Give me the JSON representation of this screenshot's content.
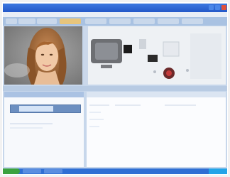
{
  "window": {
    "title": "",
    "controls": {
      "minimize": "",
      "maximize": "",
      "close": ""
    }
  },
  "menu": {
    "items": [
      "",
      "",
      "",
      ""
    ]
  },
  "tabs": [
    {
      "label": "",
      "active": false
    },
    {
      "label": "",
      "active": false
    },
    {
      "label": "",
      "active": false
    },
    {
      "label": "",
      "active": true
    },
    {
      "label": "",
      "active": false
    },
    {
      "label": "",
      "active": false
    },
    {
      "label": "",
      "active": false
    },
    {
      "label": "",
      "active": false
    },
    {
      "label": "",
      "active": false
    }
  ],
  "video": {
    "caption": ""
  },
  "preview": {
    "items": [
      "",
      "",
      ""
    ]
  },
  "connection": {
    "label": ""
  },
  "taskbar": {
    "start_label": "",
    "clock": ""
  },
  "colors": {
    "titlebar": "#2f6fd4",
    "tab_active": "#f2c66a",
    "start_button": "#3aa23f",
    "tray": "#23a4e8",
    "video_bg": "#8d8d8d",
    "panel_header": "#aac2e3"
  }
}
